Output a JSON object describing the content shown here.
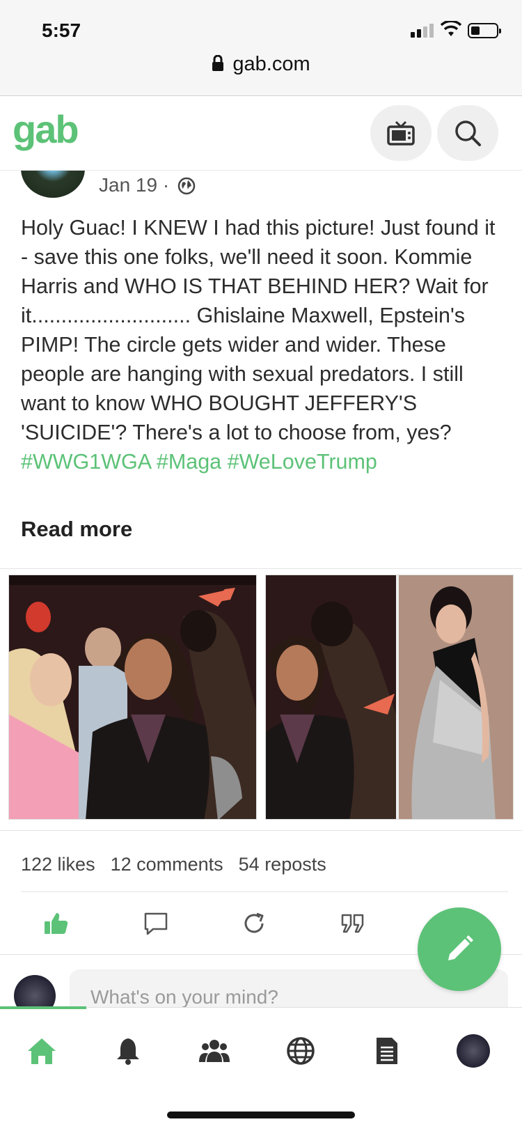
{
  "status_bar": {
    "time": "5:57"
  },
  "browser": {
    "url": "gab.com"
  },
  "app": {
    "logo": "gab"
  },
  "post": {
    "date": "Jan 19 ·",
    "text": "Holy Guac! I KNEW I had this picture! Just found it - save this one folks, we'll need it soon. Kommie Harris and WHO IS THAT BEHIND HER? Wait for it........................... Ghislaine Maxwell, Epstein's PIMP! The circle gets wider and wider. These people are hanging with sexual predators. I still want to know WHO BOUGHT JEFFERY'S 'SUICIDE'? There's a lot to choose from, yes?",
    "hashtags": "#WWG1WGA #Maga #WeLoveTrump",
    "read_more": "Read more",
    "likes": "122 likes",
    "comments": "12 comments",
    "reposts": "54 reposts"
  },
  "composer": {
    "placeholder": "What's on your mind?"
  },
  "colors": {
    "brand": "#5cc277"
  },
  "icons": [
    "lock-icon",
    "tv-icon",
    "search-icon",
    "globe-icon",
    "like-icon",
    "comment-icon",
    "repost-icon",
    "quote-icon",
    "pencil-icon",
    "home-icon",
    "bell-icon",
    "groups-icon",
    "explore-icon",
    "news-icon"
  ]
}
